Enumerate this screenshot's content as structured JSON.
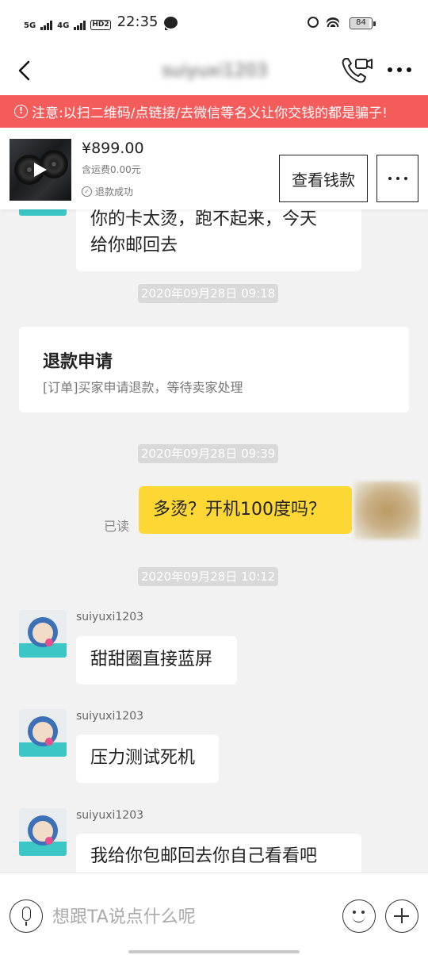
{
  "status_bar": {
    "network_1": "5G",
    "network_2": "4G",
    "hd_badge": "HD2",
    "time": "22:35",
    "battery": "84"
  },
  "header": {
    "title": "suiyuxi1203"
  },
  "warning": {
    "text": "注意:以扫二维码/点链接/去微信等名义让你交钱的都是骗子!"
  },
  "product": {
    "price": "¥899.00",
    "shipping": "含运费0.00元",
    "status": "退款成功",
    "view_button": "查看钱款"
  },
  "chat": {
    "messages_top_line1": "你的卡太烫，跑不起来，今天",
    "messages_top_line2": "给你邮回去",
    "timestamp_1": "2020年09月28日 09:18",
    "refund_card": {
      "title": "退款申请",
      "subtitle": "[订单]买家申请退款，等待卖家处理"
    },
    "timestamp_2": "2020年09月28日 09:39",
    "my_message": "多烫？开机100度吗？",
    "read_label": "已读",
    "timestamp_3": "2020年09月28日 10:12",
    "sender_name": "suiyuxi1203",
    "reply_1": "甜甜圈直接蓝屏",
    "reply_2": "压力测试死机",
    "reply_3": "我给你包邮回去你自己看看吧"
  },
  "input_bar": {
    "placeholder": "想跟TA说点什么呢"
  },
  "colors": {
    "warning_bg": "#f45b5b",
    "my_bubble": "#fdd835",
    "chat_bg": "#f2f2f2"
  }
}
